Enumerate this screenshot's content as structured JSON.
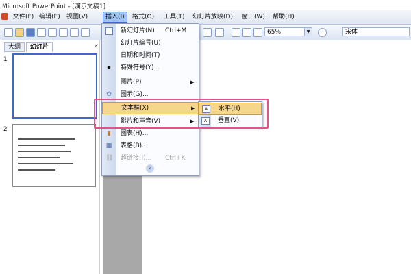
{
  "window": {
    "title": "Microsoft PowerPoint - [演示文稿1]"
  },
  "menubar": {
    "items": [
      {
        "label": "文件(F)"
      },
      {
        "label": "编辑(E)"
      },
      {
        "label": "视图(V)"
      },
      {
        "label": "插入(I)",
        "active": true
      },
      {
        "label": "格式(O)"
      },
      {
        "label": "工具(T)"
      },
      {
        "label": "幻灯片放映(D)"
      },
      {
        "label": "窗口(W)"
      },
      {
        "label": "帮助(H)"
      }
    ]
  },
  "toolbar": {
    "zoom": "65%",
    "font": "宋体"
  },
  "leftpane": {
    "tabs": [
      {
        "label": "大纲"
      },
      {
        "label": "幻灯片",
        "selected": true
      }
    ],
    "close": "×",
    "slides": [
      {
        "number": "1"
      },
      {
        "number": "2"
      }
    ]
  },
  "insert_menu": {
    "items": [
      {
        "label": "新幻灯片(N)",
        "shortcut": "Ctrl+M",
        "icon": "new-slide-icon"
      },
      {
        "label": "幻灯片编号(U)"
      },
      {
        "label": "日期和时间(T)"
      },
      {
        "label": "特殊符号(Y)...",
        "icon": "special-symbol-icon",
        "icon_glyph": "●"
      },
      {
        "label": "图片(P)",
        "submenu": true
      },
      {
        "label": "图示(G)...",
        "icon": "diagram-icon",
        "icon_glyph": "✿"
      },
      {
        "label": "文本框(X)",
        "submenu": true,
        "highlighted": true
      },
      {
        "label": "影片和声音(V)",
        "submenu": true
      },
      {
        "label": "图表(H)...",
        "icon": "chart-icon",
        "icon_glyph": "▮"
      },
      {
        "label": "表格(B)...",
        "icon": "table-icon",
        "icon_glyph": "▦"
      },
      {
        "label": "超链接(I)...",
        "shortcut": "Ctrl+K",
        "disabled": true,
        "icon": "hyperlink-icon",
        "icon_glyph": "⛓"
      }
    ],
    "expand": "»"
  },
  "textbox_submenu": {
    "items": [
      {
        "label": "水平(H)",
        "highlighted": true,
        "icon": "horizontal-textbox-icon",
        "icon_glyph": "A"
      },
      {
        "label": "垂直(V)",
        "icon": "vertical-textbox-icon",
        "icon_glyph": "A"
      }
    ]
  },
  "colors": {
    "highlight_outline": "#e8508a",
    "menu_hover": "#f5d68a"
  }
}
